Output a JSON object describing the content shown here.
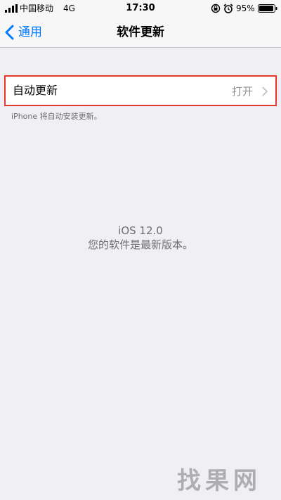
{
  "status_bar": {
    "carrier": "中国移动",
    "network": "4G",
    "time": "17:30",
    "battery_percent": "95%",
    "battery_level": 0.95,
    "icons": [
      "signal-bars-icon",
      "orientation-lock-icon",
      "alarm-clock-icon",
      "battery-icon"
    ]
  },
  "nav": {
    "back_label": "通用",
    "back_icon": "chevron-left-icon",
    "title": "软件更新"
  },
  "auto_update": {
    "label": "自动更新",
    "value": "打开",
    "icon": "chevron-right-icon"
  },
  "footer_note": "iPhone 将自动安装更新。",
  "version": {
    "os": "iOS 12.0",
    "status": "您的软件是最新版本。"
  },
  "watermark": {
    "text": "找果网"
  },
  "colors": {
    "accent": "#007aff",
    "background": "#efeff4",
    "highlight_border": "#e23b2e",
    "secondary_text": "#8e8e93"
  }
}
